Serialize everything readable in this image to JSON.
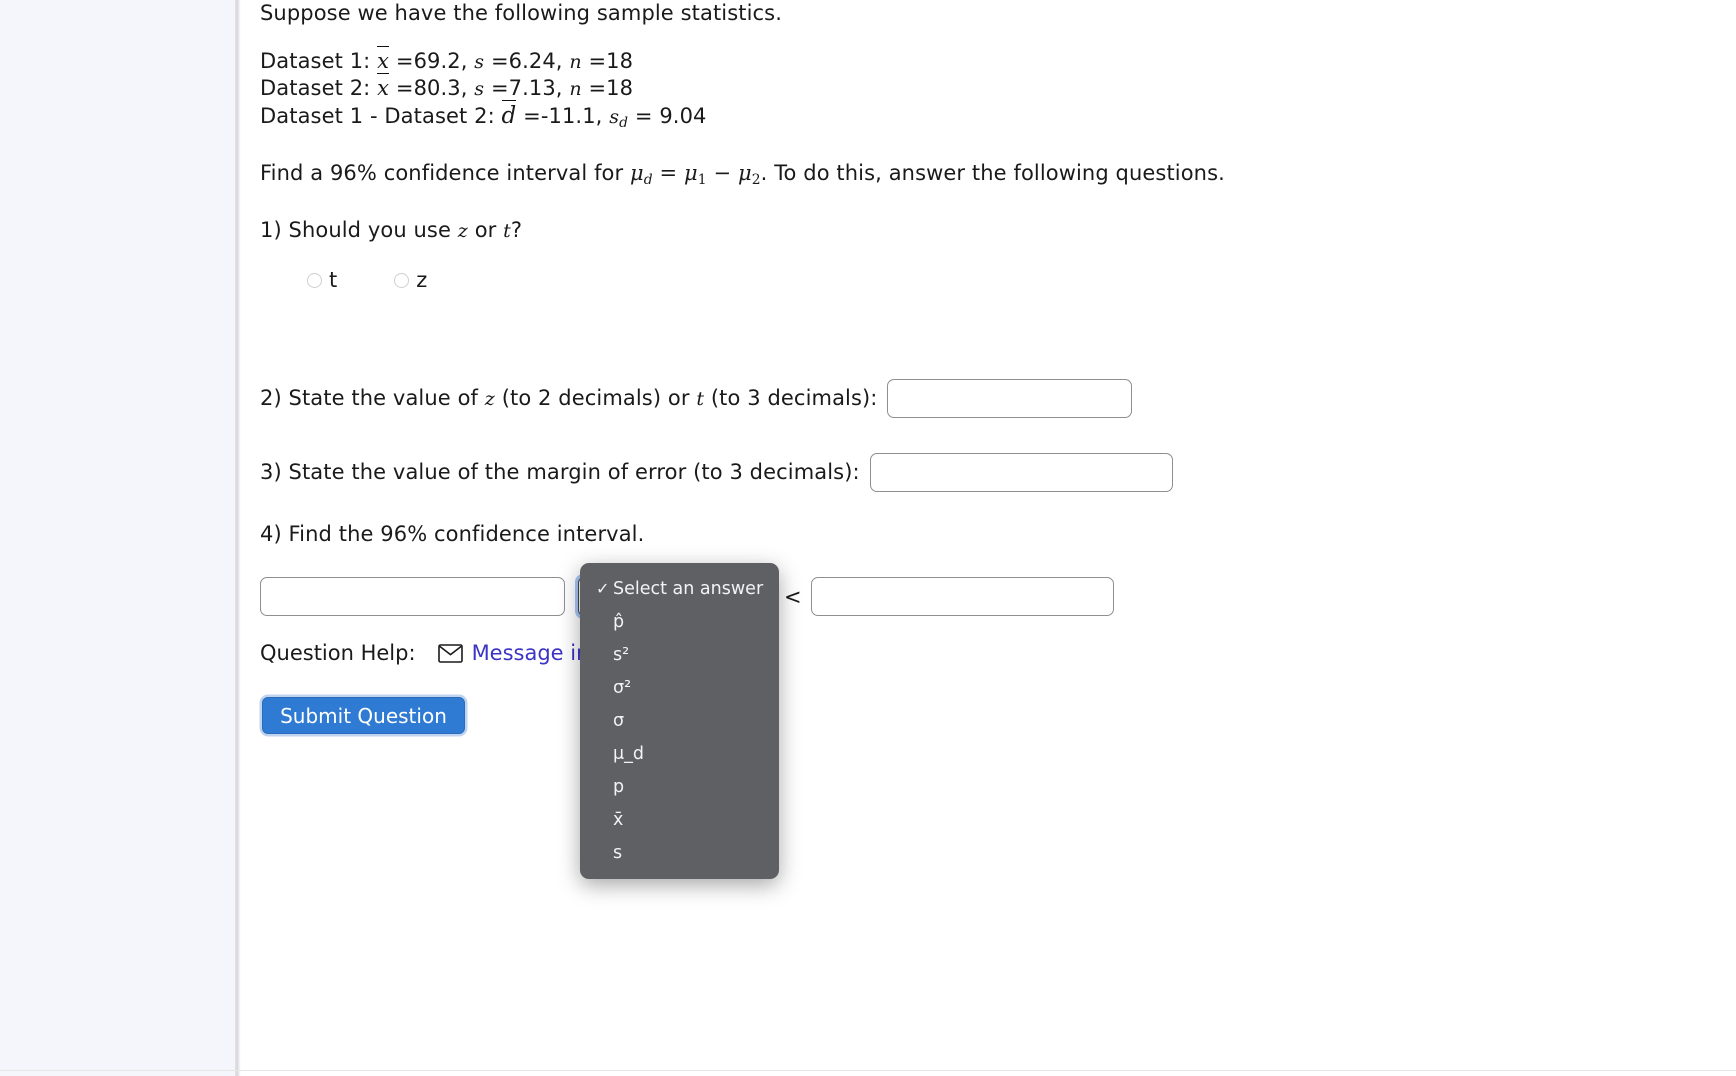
{
  "problem": {
    "intro": "Suppose we have the following sample statistics.",
    "datasets": [
      {
        "label": "Dataset 1:",
        "mean_sym": "x",
        "mean": "=69.2,",
        "s_sym": "s",
        "s": "=6.24,",
        "n_sym": "n",
        "n": "=18"
      },
      {
        "label": "Dataset 2:",
        "mean_sym": "x",
        "mean": "=80.3,",
        "s_sym": "s",
        "s": "=7.13,",
        "n_sym": "n",
        "n": "=18"
      }
    ],
    "difference": {
      "label": "Dataset 1 - Dataset 2:",
      "d_sym": "d",
      "d_value": "=-11.1,",
      "sd_sym": "s",
      "sd_subscript": "d",
      "sd_value": "= 9.04"
    },
    "find_prefix": "Find a 96% confidence interval for",
    "find_mu_d": "μ",
    "find_mu_d_sub": "d",
    "find_equals": "=",
    "find_mu1": "μ",
    "find_mu1_sub": "1",
    "find_minus": "−",
    "find_mu2": "μ",
    "find_mu2_sub": "2",
    "find_suffix": ". To do this, answer the following questions."
  },
  "questions": {
    "q1": {
      "prefix": "1) Should you use",
      "z_sym": "z",
      "middle": "or",
      "t_sym": "t",
      "suffix": "?",
      "options": [
        {
          "label": "t",
          "selected": false
        },
        {
          "label": "z",
          "selected": false
        }
      ]
    },
    "q2": {
      "prefix": "2) State the value of",
      "z_sym": "z",
      "mid1": "(to 2 decimals) or",
      "t_sym": "t",
      "mid2": "(to 3 decimals):",
      "value": "",
      "placeholder": ""
    },
    "q3": {
      "text": "3) State the value of the margin of error (to 3 decimals):",
      "value": "",
      "placeholder": ""
    },
    "q4": {
      "text": "4) Find the 96% confidence interval.",
      "lower_value": "",
      "lower_placeholder": "",
      "comparator": "<",
      "select_value": "Select an answer",
      "upper_value": "",
      "upper_placeholder": ""
    }
  },
  "dropdown": {
    "items": [
      {
        "label": "Select an answer",
        "checked": true
      },
      {
        "label": "p̂",
        "checked": false
      },
      {
        "label": "s²",
        "checked": false
      },
      {
        "label": "σ²",
        "checked": false
      },
      {
        "label": "σ",
        "checked": false
      },
      {
        "label": "μ_d",
        "checked": false
      },
      {
        "label": "p",
        "checked": false
      },
      {
        "label": "x̄",
        "checked": false
      },
      {
        "label": "s",
        "checked": false
      }
    ],
    "check_glyph": "✓",
    "background_color": "#5f6063",
    "text_color": "#f3f3f4"
  },
  "footer": {
    "help_label": "Question Help:",
    "mail_icon": "envelope-icon",
    "message_link": "Message inst",
    "submit_label": "Submit Question",
    "submit_color": "#2f7bd4"
  }
}
